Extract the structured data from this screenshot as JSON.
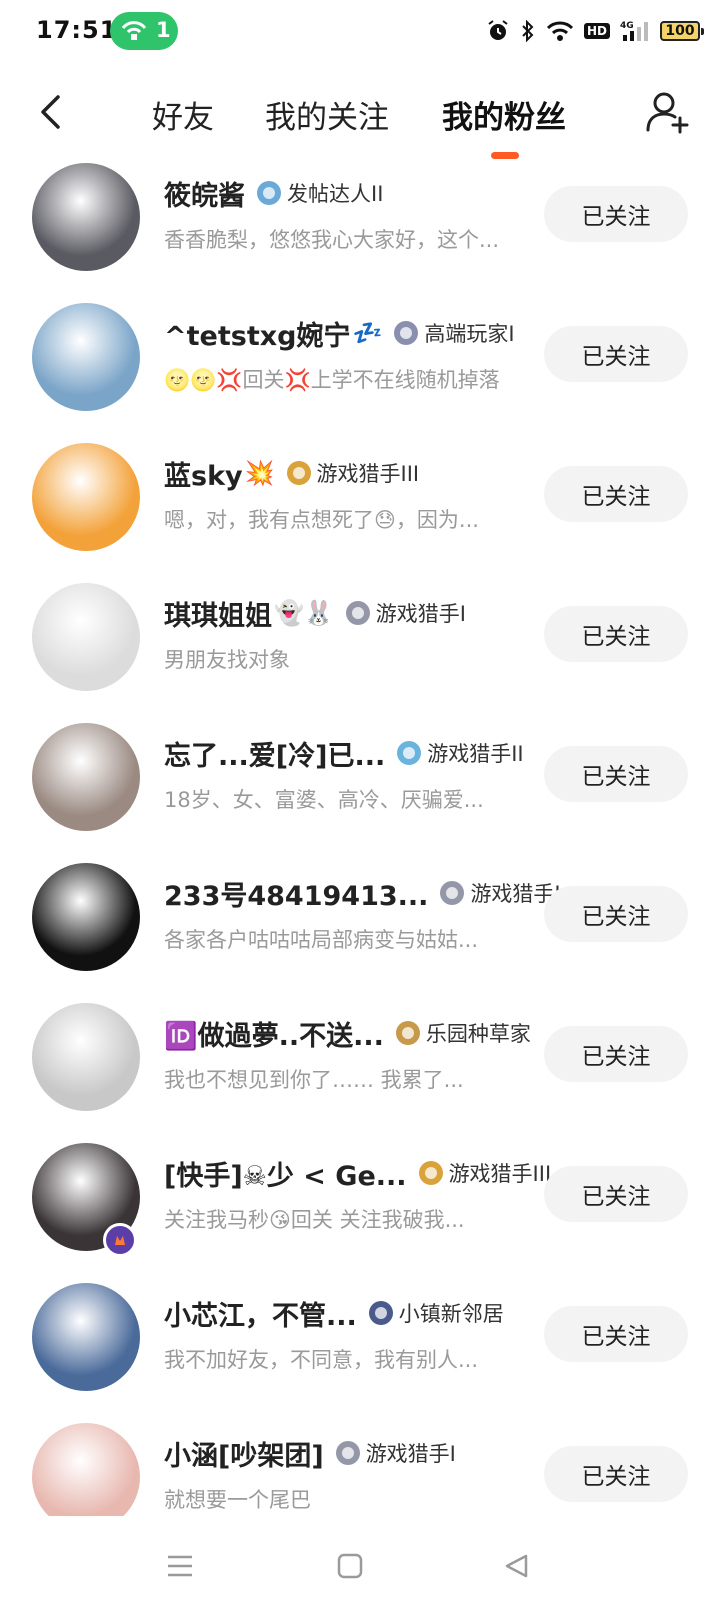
{
  "status_bar": {
    "time": "17:51",
    "hotspot_count": "1",
    "battery": "100",
    "icons": [
      "alarm-icon",
      "bluetooth-icon",
      "wifi-icon",
      "hd-icon",
      "signal-icon",
      "battery-icon"
    ],
    "hd_label": "HD",
    "signal_label": "4G"
  },
  "header": {
    "tabs": [
      {
        "label": "好友",
        "active": false
      },
      {
        "label": "我的关注",
        "active": false
      },
      {
        "label": "我的粉丝",
        "active": true
      }
    ],
    "accent_color": "#fe5a24"
  },
  "follow_label": "已关注",
  "fans": [
    {
      "name": "筱皖酱",
      "emoji": "",
      "level": "发帖达人II",
      "bio": "香香脆梨，悠悠我心大家好，这个...",
      "level_color": "#6aa9d8",
      "avatar_color": "#5a5a62"
    },
    {
      "name": "^tetstxg婉宁",
      "emoji": "💤",
      "level": "高端玩家I",
      "bio": "🌝🌝💢回关💢上学不在线随机掉落",
      "level_color": "#8a8fb0",
      "avatar_color": "#7aa4c8"
    },
    {
      "name": "蓝sky",
      "emoji": "💥",
      "level": "游戏猎手III",
      "bio": "嗯，对，我有点想死了😓，因为...",
      "level_color": "#d9a23a",
      "avatar_color": "#f3a23a"
    },
    {
      "name": "琪琪姐姐",
      "emoji": "👻🐰",
      "level": "游戏猎手I",
      "bio": "男朋友找对象",
      "level_color": "#9497a8",
      "avatar_color": "#dcdcdc"
    },
    {
      "name": "忘了...爱[冷]已...",
      "emoji": "",
      "level": "游戏猎手II",
      "bio": "18岁、女、富婆、高冷、厌骗爱...",
      "level_color": "#6ab3dd",
      "avatar_color": "#9a8a82"
    },
    {
      "name": "233号48419413...",
      "emoji": "",
      "level": "游戏猎手I",
      "bio": "各家各户咕咕咕局部病变与姑姑...",
      "level_color": "#9497a8",
      "avatar_color": "#111111"
    },
    {
      "name": "🆔做過夢..不送...",
      "emoji": "",
      "level": "乐园种草家",
      "bio": "我也不想见到你了…… 我累了...",
      "level_color": "#c79a4a",
      "avatar_color": "#c8c8c8"
    },
    {
      "name": "[快手]☠少 < Ge...",
      "emoji": "",
      "level": "游戏猎手III",
      "bio": "关注我马秒😘回关 关注我破我...",
      "level_color": "#d9a23a",
      "avatar_color": "#3a3436"
    },
    {
      "name": "小芯江，不管...",
      "emoji": "",
      "level": "小镇新邻居",
      "bio": "我不加好友，不同意，我有别人...",
      "level_color": "#4a5a8a",
      "avatar_color": "#4a6a9a"
    },
    {
      "name": "小涵[吵架团]",
      "emoji": "",
      "level": "游戏猎手I",
      "bio": "就想要一个尾巴",
      "level_color": "#9497a8",
      "avatar_color": "#e8b8b0"
    }
  ],
  "bottom_nav": {
    "icons": [
      "menu-icon",
      "home-icon",
      "back-triangle-icon"
    ]
  }
}
